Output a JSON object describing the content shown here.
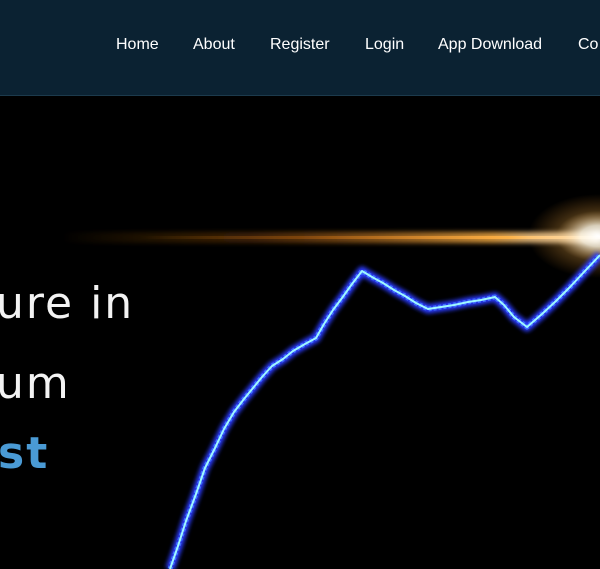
{
  "nav": {
    "items": [
      {
        "label": "Home"
      },
      {
        "label": "About"
      },
      {
        "label": "Register"
      },
      {
        "label": "Login"
      },
      {
        "label": "App Download"
      },
      {
        "label": "Co"
      }
    ]
  },
  "hero": {
    "line1": "ure in",
    "line2": "um",
    "line3": "st"
  },
  "colors": {
    "navbar_bg": "#0b2232",
    "hero_bg": "#000000",
    "hero_text": "#f3f3f3",
    "hero_accent": "#4a9ad4",
    "chart_line_glow": "#2a3bff",
    "chart_line_core": "#7ff0ff",
    "flare": "#ff9a1f"
  }
}
